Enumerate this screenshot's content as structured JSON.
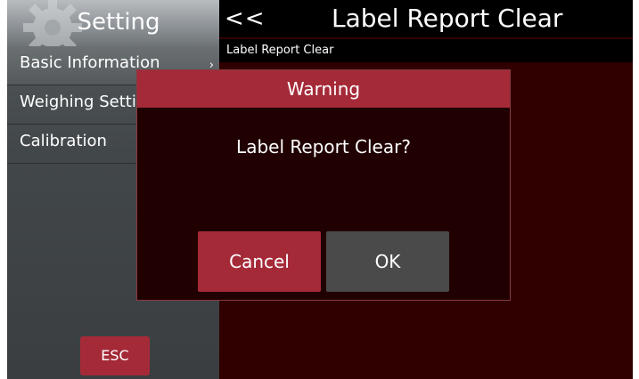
{
  "sidebar": {
    "title": "Setting",
    "items": [
      {
        "label": "Basic Information",
        "chevron": "›"
      },
      {
        "label": "Weighing Setting"
      },
      {
        "label": "Calibration"
      }
    ],
    "esc_label": "ESC"
  },
  "header": {
    "back_label": "<<",
    "title": "Label Report Clear",
    "breadcrumb": "Label Report Clear"
  },
  "dialog": {
    "title": "Warning",
    "message": "Label Report Clear?",
    "cancel_label": "Cancel",
    "ok_label": "OK"
  },
  "colors": {
    "accent": "#a52a38",
    "background": "#300000",
    "ok_button": "#4a4a4a"
  },
  "icons": {
    "header_decoration": "gear-icon",
    "menu_chevron": "chevron-right-icon"
  }
}
